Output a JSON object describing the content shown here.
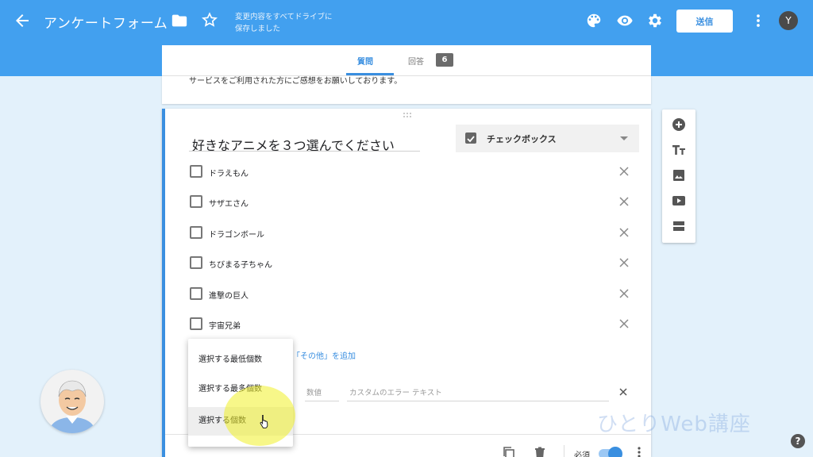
{
  "header": {
    "title": "アンケートフォーム",
    "saved_line1": "変更内容をすべてドライブに",
    "saved_line2": "保存しました",
    "send_label": "送信",
    "avatar_letter": "Y"
  },
  "tabs": {
    "questions": "質問",
    "responses": "回答",
    "responses_count": "6"
  },
  "description": "サービスをご利用された方にご感想をお願いしております。",
  "question": {
    "title": "好きなアニメを３つ選んでください",
    "type_label": "チェックボックス",
    "options": [
      "ドラえもん",
      "サザエさん",
      "ドラゴンボール",
      "ちびまる子ちゃん",
      "進撃の巨人",
      "宇宙兄弟"
    ],
    "add_other": "「その他」を追加",
    "number_placeholder": "数値",
    "error_placeholder": "カスタムのエラー テキスト",
    "required_label": "必須"
  },
  "validation_menu": {
    "items": [
      "選択する最低個数",
      "選択する最多個数",
      "選択する個数"
    ],
    "selected": "選択する個数"
  },
  "watermark": "ひとりWeb講座",
  "help_label": "?"
}
